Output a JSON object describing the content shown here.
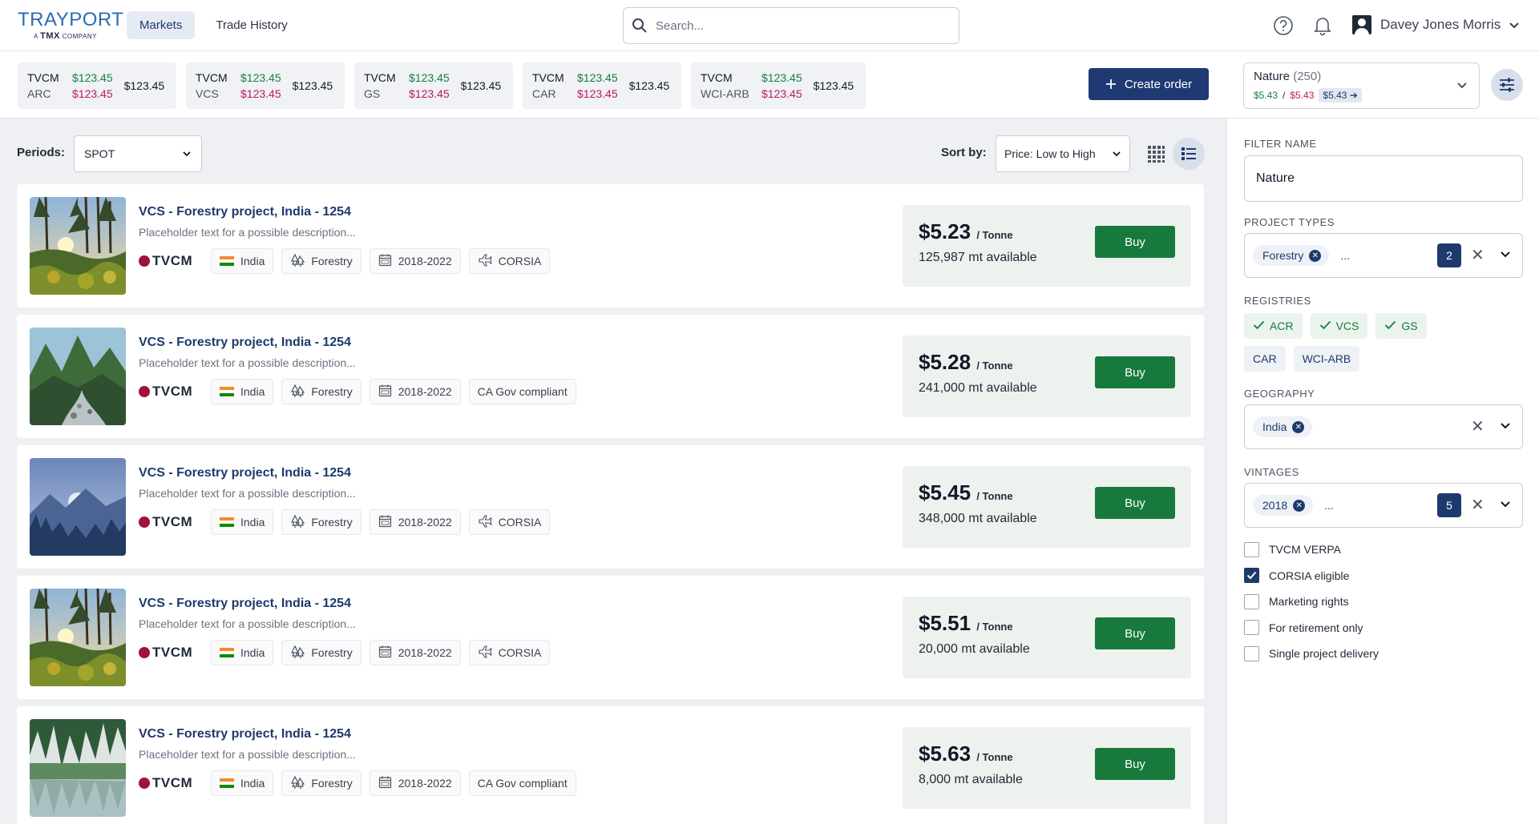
{
  "header": {
    "logo_main": "TRAYPORT",
    "logo_sub_prefix": "A",
    "logo_sub_brand": "TMX",
    "logo_sub_suffix": "COMPANY",
    "nav": [
      {
        "label": "Markets",
        "active": true
      },
      {
        "label": "Trade History",
        "active": false
      }
    ],
    "search_placeholder": "Search...",
    "user_name": "Davey Jones Morris"
  },
  "tickers": [
    {
      "symbol": "TVCM",
      "registry": "ARC",
      "bid": "$123.45",
      "ask": "$123.45",
      "last": "$123.45"
    },
    {
      "symbol": "TVCM",
      "registry": "VCS",
      "bid": "$123.45",
      "ask": "$123.45",
      "last": "$123.45"
    },
    {
      "symbol": "TVCM",
      "registry": "GS",
      "bid": "$123.45",
      "ask": "$123.45",
      "last": "$123.45"
    },
    {
      "symbol": "TVCM",
      "registry": "CAR",
      "bid": "$123.45",
      "ask": "$123.45",
      "last": "$123.45"
    },
    {
      "symbol": "TVCM",
      "registry": "WCI-ARB",
      "bid": "$123.45",
      "ask": "$123.45",
      "last": "$123.45"
    }
  ],
  "create_order_label": "Create order",
  "saved_filter": {
    "name": "Nature",
    "count": "(250)",
    "bid": "$5.43",
    "separator": "/",
    "ask": "$5.43",
    "last": "$5.43"
  },
  "toolbar": {
    "periods_label": "Periods:",
    "periods_value": "SPOT",
    "sort_label": "Sort by:",
    "sort_value": "Price: Low to High"
  },
  "listings": [
    {
      "title": "VCS - Forestry project, India - 1254",
      "description": "Placeholder text for a possible description...",
      "brand": "TVCM",
      "country": "India",
      "type": "Forestry",
      "vintage": "2018-2022",
      "label": "CORSIA",
      "label_icon": "plane-icon",
      "price": "$5.23",
      "unit": "/ Tonne",
      "available": "125,987 mt available",
      "buy": "Buy",
      "image": "forest-sunset"
    },
    {
      "title": "VCS - Forestry project, India - 1254",
      "description": "Placeholder text for a possible description...",
      "brand": "TVCM",
      "country": "India",
      "type": "Forestry",
      "vintage": "2018-2022",
      "label": "CA Gov compliant",
      "label_icon": "",
      "price": "$5.28",
      "unit": "/ Tonne",
      "available": "241,000 mt available",
      "buy": "Buy",
      "image": "river-valley"
    },
    {
      "title": "VCS - Forestry project, India - 1254",
      "description": "Placeholder text for a possible description...",
      "brand": "TVCM",
      "country": "India",
      "type": "Forestry",
      "vintage": "2018-2022",
      "label": "CORSIA",
      "label_icon": "plane-icon",
      "price": "$5.45",
      "unit": "/ Tonne",
      "available": "348,000 mt available",
      "buy": "Buy",
      "image": "blue-mountains"
    },
    {
      "title": "VCS - Forestry project, India - 1254",
      "description": "Placeholder text for a possible description...",
      "brand": "TVCM",
      "country": "India",
      "type": "Forestry",
      "vintage": "2018-2022",
      "label": "CORSIA",
      "label_icon": "plane-icon",
      "price": "$5.51",
      "unit": "/ Tonne",
      "available": "20,000 mt available",
      "buy": "Buy",
      "image": "forest-sunset"
    },
    {
      "title": "VCS - Forestry project, India - 1254",
      "description": "Placeholder text for a possible description...",
      "brand": "TVCM",
      "country": "India",
      "type": "Forestry",
      "vintage": "2018-2022",
      "label": "CA Gov compliant",
      "label_icon": "",
      "price": "$5.63",
      "unit": "/ Tonne",
      "available": "8,000 mt available",
      "buy": "Buy",
      "image": "lake-forest"
    }
  ],
  "sidebar": {
    "filter_name_label": "FILTER NAME",
    "filter_name_value": "Nature",
    "project_types_label": "PROJECT TYPES",
    "project_types_chip": "Forestry",
    "project_types_more": "...",
    "project_types_count": "2",
    "registries_label": "REGISTRIES",
    "registries": [
      {
        "label": "ACR",
        "selected": true
      },
      {
        "label": "VCS",
        "selected": true
      },
      {
        "label": "GS",
        "selected": true
      },
      {
        "label": "CAR",
        "selected": false
      },
      {
        "label": "WCI-ARB",
        "selected": false
      }
    ],
    "geography_label": "GEOGRAPHY",
    "geography_chip": "India",
    "vintages_label": "VINTAGES",
    "vintages_chip": "2018",
    "vintages_more": "...",
    "vintages_count": "5",
    "checkboxes": [
      {
        "label": "TVCM VERPA",
        "checked": false
      },
      {
        "label": "CORSIA eligible",
        "checked": true
      },
      {
        "label": "Marketing rights",
        "checked": false
      },
      {
        "label": "For retirement only",
        "checked": false
      },
      {
        "label": "Single project delivery",
        "checked": false
      }
    ]
  },
  "colors": {
    "primary": "#1e3a6d",
    "buy_green": "#177a3c",
    "price_up": "#15803d",
    "price_down": "#c0185a",
    "brand_dot": "#9f1239"
  }
}
